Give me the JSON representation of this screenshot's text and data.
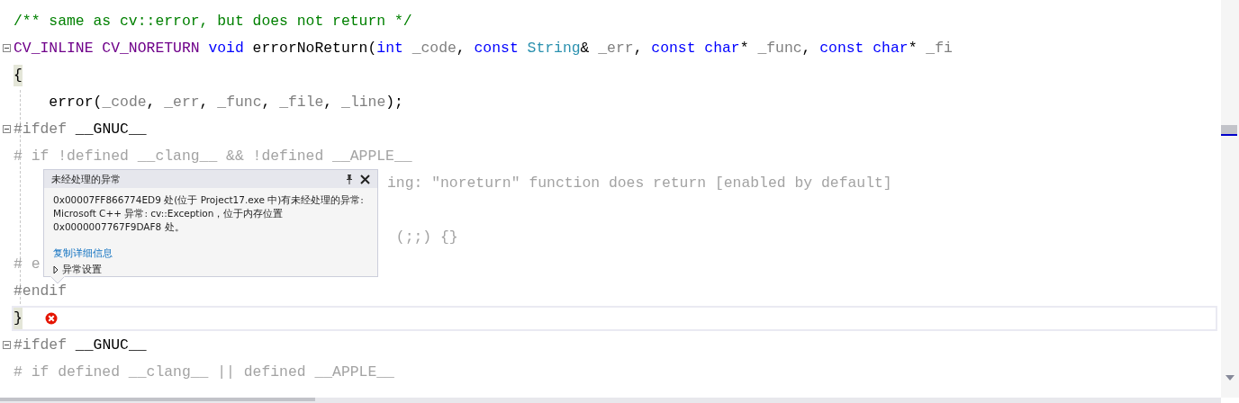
{
  "editor": {
    "lines": [
      {
        "fold": false,
        "segments": [
          {
            "kind": "comment",
            "text": "/** same as cv::error, but does not return */"
          }
        ]
      },
      {
        "fold": true,
        "segments": [
          {
            "kind": "macro",
            "text": "CV_INLINE CV_NORETURN"
          },
          {
            "kind": "keyword",
            "text": " void"
          },
          {
            "kind": "plain",
            "text": " errorNoReturn("
          },
          {
            "kind": "keyword",
            "text": "int"
          },
          {
            "kind": "param",
            "text": " _code"
          },
          {
            "kind": "plain",
            "text": ", "
          },
          {
            "kind": "keyword",
            "text": "const"
          },
          {
            "kind": "type",
            "text": " String"
          },
          {
            "kind": "plain",
            "text": "& "
          },
          {
            "kind": "param",
            "text": "_err"
          },
          {
            "kind": "plain",
            "text": ", "
          },
          {
            "kind": "keyword",
            "text": "const"
          },
          {
            "kind": "keyword",
            "text": " char"
          },
          {
            "kind": "plain",
            "text": "* "
          },
          {
            "kind": "param",
            "text": "_func"
          },
          {
            "kind": "plain",
            "text": ", "
          },
          {
            "kind": "keyword",
            "text": "const"
          },
          {
            "kind": "keyword",
            "text": " char"
          },
          {
            "kind": "plain",
            "text": "* "
          },
          {
            "kind": "param",
            "text": "_fi"
          }
        ]
      },
      {
        "fold": false,
        "segments": [
          {
            "kind": "brace",
            "text": "{"
          }
        ]
      },
      {
        "fold": false,
        "segments": [
          {
            "kind": "plain",
            "text": "    error("
          },
          {
            "kind": "param",
            "text": "_code"
          },
          {
            "kind": "plain",
            "text": ", "
          },
          {
            "kind": "param",
            "text": "_err"
          },
          {
            "kind": "plain",
            "text": ", "
          },
          {
            "kind": "param",
            "text": "_func"
          },
          {
            "kind": "plain",
            "text": ", "
          },
          {
            "kind": "param",
            "text": "_file"
          },
          {
            "kind": "plain",
            "text": ", "
          },
          {
            "kind": "param",
            "text": "_line"
          },
          {
            "kind": "plain",
            "text": ");"
          }
        ]
      },
      {
        "fold": true,
        "segments": [
          {
            "kind": "preproc",
            "text": "#ifdef"
          },
          {
            "kind": "plain",
            "text": " __GNUC__"
          }
        ]
      },
      {
        "fold": false,
        "segments": [
          {
            "kind": "inactive",
            "text": "# if !defined __clang__ && !defined __APPLE__"
          }
        ]
      },
      {
        "fold": false,
        "behind_popup": true,
        "segments": [
          {
            "kind": "inactive",
            "text": "ing: ″noreturn″ function does return [enabled by default]"
          }
        ]
      },
      {
        "fold": false
      },
      {
        "fold": false,
        "behind_popup": true,
        "segments": [
          {
            "kind": "inactive",
            "text": " (;;) {}"
          }
        ]
      },
      {
        "fold": false,
        "segments": [
          {
            "kind": "inactive",
            "text": "# e"
          }
        ]
      },
      {
        "fold": false,
        "segments": [
          {
            "kind": "preproc",
            "text": "#endif"
          }
        ]
      },
      {
        "fold": false,
        "current": true,
        "exception_marker": true,
        "segments": [
          {
            "kind": "brace",
            "text": "}"
          }
        ]
      },
      {
        "fold": true,
        "segments": [
          {
            "kind": "preproc",
            "text": "#ifdef"
          },
          {
            "kind": "plain",
            "text": " __GNUC__"
          }
        ]
      },
      {
        "fold": false,
        "segments": [
          {
            "kind": "inactive",
            "text": "# if defined __clang__ || defined __APPLE__"
          }
        ]
      }
    ]
  },
  "popup": {
    "title": "未经处理的异常",
    "message": "0x00007FF866774ED9 处(位于 Project17.exe 中)有未经处理的异常: Microsoft C++ 异常: cv::Exception，位于内存位置 0x0000007767F9DAF8 处。",
    "link": "复制详细信息",
    "settings": {
      "label": "异常设置",
      "expanded": false
    }
  }
}
